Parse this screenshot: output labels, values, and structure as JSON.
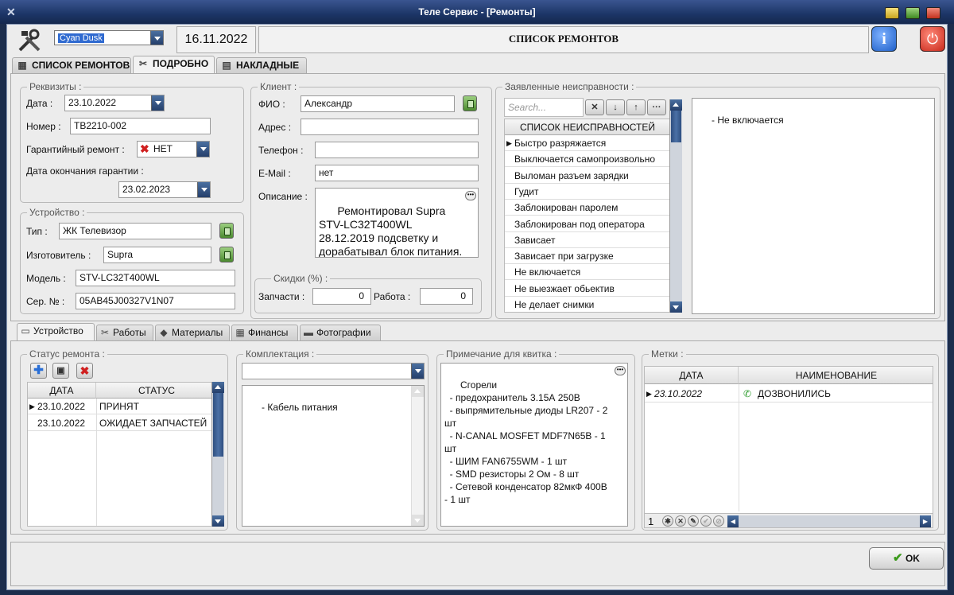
{
  "window": {
    "title": "Теле Сервис - [Ремонты]"
  },
  "header": {
    "theme_select": "Cyan Dusk",
    "current_date": "16.11.2022",
    "page_title": "СПИСОК РЕМОНТОВ"
  },
  "tabs": [
    {
      "label": "СПИСОК РЕМОНТОВ"
    },
    {
      "label": "ПОДРОБНО"
    },
    {
      "label": "НАКЛАДНЫЕ"
    }
  ],
  "details": {
    "title": "Реквизиты :",
    "date_label": "Дата :",
    "date_value": "23.10.2022",
    "number_label": "Номер :",
    "number_value": "ТВ2210-002",
    "warranty_label": "Гарантийный ремонт :",
    "warranty_value": "НЕТ",
    "warranty_end_label": "Дата окончания гарантии :",
    "warranty_end_value": "23.02.2023"
  },
  "device": {
    "title": "Устройство :",
    "type_label": "Тип :",
    "type_value": "ЖК Телевизор",
    "maker_label": "Изготовитель :",
    "maker_value": "Supra",
    "model_label": "Модель :",
    "model_value": "STV-LC32T400WL",
    "serial_label": "Сер. № :",
    "serial_value": "05AB45J00327V1N07"
  },
  "client": {
    "title": "Клиент :",
    "name_label": "ФИО :",
    "name_value": "Александр",
    "address_label": "Адрес :",
    "address_value": "",
    "phone_label": "Телефон :",
    "phone_value": "",
    "email_label": "E-Mail :",
    "email_value": "нет",
    "desc_label": "Описание :",
    "desc_value": "Ремонтировал Supra STV-LC32T400WL 28.12.2019 подсветку и дорабатывал блок питания. Второй ремонт (сгорел блок"
  },
  "discounts": {
    "title": "Скидки (%) :",
    "parts_label": "Запчасти :",
    "parts_value": "0",
    "work_label": "Работа :",
    "work_value": "0"
  },
  "faults": {
    "title": "Заявленные неисправности :",
    "search_placeholder": "Search...",
    "list_header": "СПИСОК НЕИСПРАВНОСТЕЙ",
    "items": [
      "Быстро разряжается",
      "Выключается самопроизвольно",
      "Выломан разъем зарядки",
      "Гудит",
      "Заблокирован паролем",
      "Заблокирован под оператора",
      "Зависает",
      "Зависает при загрузке",
      "Не включается",
      "Не выезжает обьектив",
      "Не делает снимки"
    ],
    "selected_text": "- Не включается"
  },
  "bottom_tabs": [
    {
      "label": "Устройство"
    },
    {
      "label": "Работы"
    },
    {
      "label": "Материалы"
    },
    {
      "label": "Финансы"
    },
    {
      "label": "Фотографии"
    }
  ],
  "status": {
    "title": "Статус ремонта :",
    "col_date": "ДАТА",
    "col_status": "СТАТУС",
    "rows": [
      {
        "date": "23.10.2022",
        "status": "ПРИНЯТ"
      },
      {
        "date": "23.10.2022",
        "status": "ОЖИДАЕТ ЗАПЧАСТЕЙ"
      }
    ]
  },
  "kit": {
    "title": "Комплектация :",
    "items_text": "- Кабель питания"
  },
  "note": {
    "title": "Примечание для квитка :",
    "text": "Сгорели\n  - предохранитель 3.15А 250В\n  - выпрямительные диоды LR207 - 2 шт\n  - N-CANAL MOSFET MDF7N65B - 1 шт\n  - ШИМ FAN6755WM - 1 шт\n  - SMD резисторы 2 Ом - 8 шт\n  - Сетевой конденсатор 82мкФ 400В - 1 шт"
  },
  "marks": {
    "title": "Метки :",
    "col_date": "ДАТА",
    "col_name": "НАИМЕНОВАНИЕ",
    "rows": [
      {
        "date": "23.10.2022",
        "name": "ДОЗВОНИЛИСЬ"
      }
    ],
    "page_number": "1"
  },
  "footer": {
    "ok_label": "OK"
  },
  "colors": {
    "accent": "#1c3566",
    "info_button": "#2a6fd6",
    "power_button": "#d83a2a"
  },
  "icons": [
    "tools-icon",
    "info-icon",
    "power-icon",
    "plus-icon",
    "save-icon",
    "delete-icon",
    "phone-icon",
    "check-icon"
  ]
}
